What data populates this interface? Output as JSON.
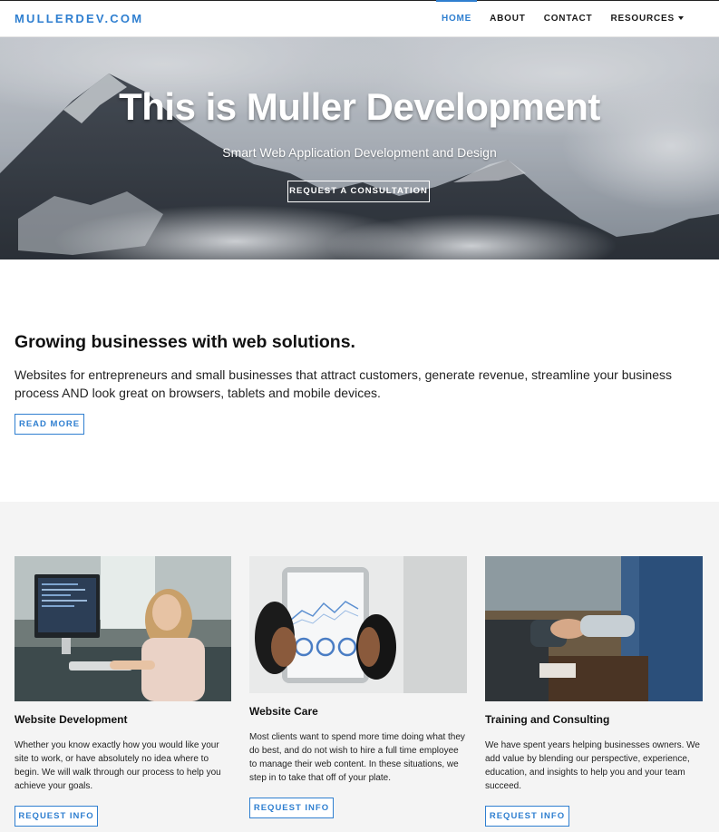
{
  "navbar": {
    "brand": "MULLERDEV.COM",
    "links": [
      {
        "label": "HOME",
        "active": true
      },
      {
        "label": "ABOUT",
        "active": false
      },
      {
        "label": "CONTACT",
        "active": false
      },
      {
        "label": "RESOURCES",
        "active": false,
        "dropdown": true
      }
    ]
  },
  "hero": {
    "title": "This is Muller Development",
    "subtitle": "Smart Web Application Development and Design",
    "cta_label": "REQUEST A CONSULTATION"
  },
  "intro": {
    "heading": "Growing businesses with web solutions.",
    "body": "Websites for entrepreneurs and small businesses that attract customers, generate revenue, streamline your business process AND look great on browsers, tablets and mobile devices.",
    "read_more_label": "READ MORE"
  },
  "services": [
    {
      "title": "Website Development",
      "text": "Whether you know exactly how you would like your site to work, or have absolutely no idea where to begin. We will walk through our process to help you achieve your goals.",
      "button_label": "REQUEST INFO"
    },
    {
      "title": "Website Care",
      "text": "Most clients want to spend more time doing what they do best, and do not wish to hire a full time employee to manage their web content. In these situations, we step in to take that off of your plate.",
      "button_label": "REQUEST INFO"
    },
    {
      "title": "Training and Consulting",
      "text": "We have spent years helping businesses owners. We add value by blending our perspective, experience, education, and insights to help you and your team succeed.",
      "button_label": "REQUEST INFO"
    }
  ],
  "colors": {
    "accent": "#2f7fd0",
    "section_bg": "#f4f4f4",
    "text": "#111111"
  }
}
